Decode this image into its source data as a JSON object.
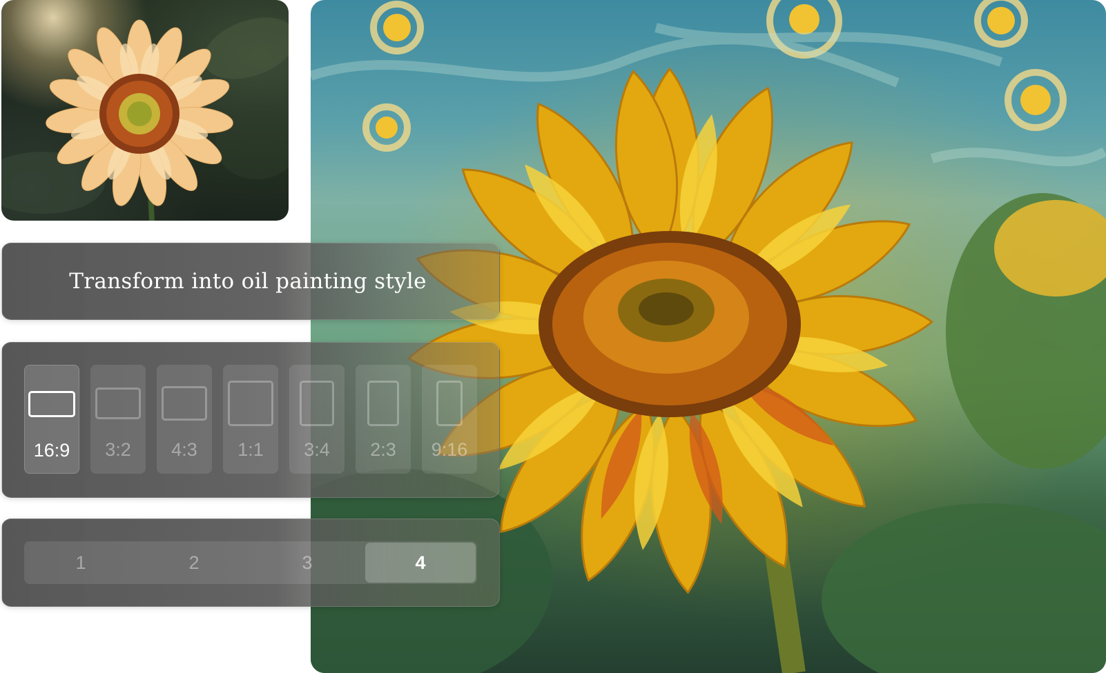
{
  "source_photo": {
    "description_icon": "sunflower-photo"
  },
  "result_image": {
    "description_icon": "oil-painting-sunflower"
  },
  "prompt": {
    "text": "Transform into oil painting style"
  },
  "aspect_ratios": {
    "selected": "16:9",
    "options": [
      {
        "label": "16:9"
      },
      {
        "label": "3:2"
      },
      {
        "label": "4:3"
      },
      {
        "label": "1:1"
      },
      {
        "label": "3:4"
      },
      {
        "label": "2:3"
      },
      {
        "label": "9:16"
      }
    ]
  },
  "image_count": {
    "selected": "4",
    "options": [
      {
        "label": "1"
      },
      {
        "label": "2"
      },
      {
        "label": "3"
      },
      {
        "label": "4"
      }
    ]
  },
  "colors": {
    "panel": "#585858",
    "selected_text": "#ffffff",
    "sunflower_yellow": "#f2b818",
    "sky_teal": "#4a95a8"
  }
}
